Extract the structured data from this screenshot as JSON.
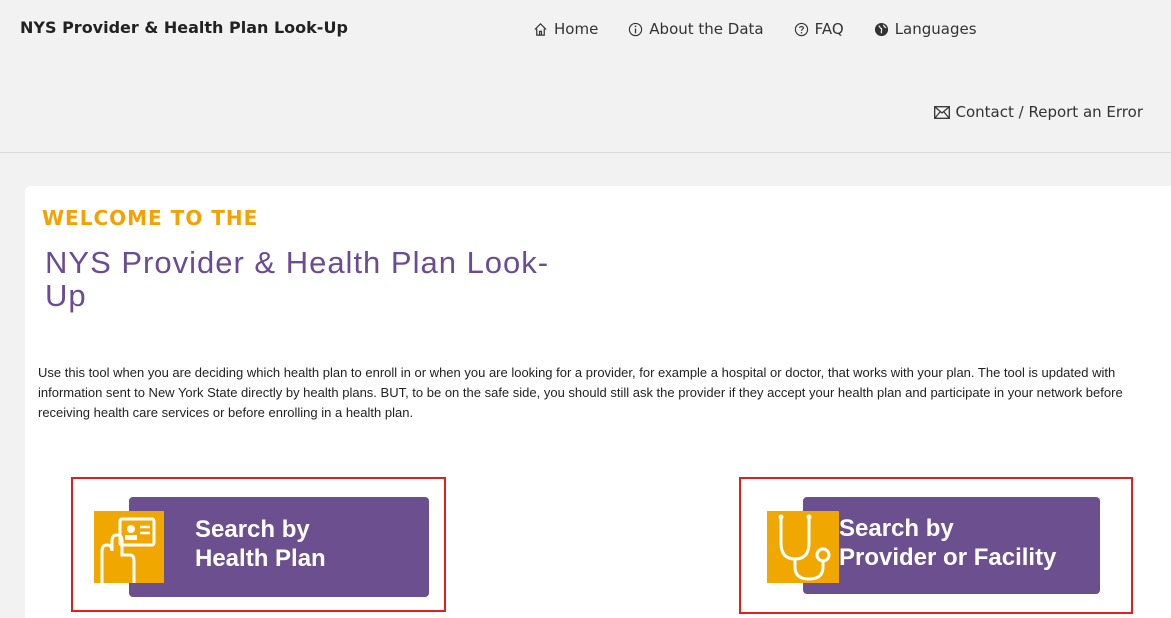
{
  "header": {
    "brand": "NYS Provider & Health Plan Look-Up",
    "nav": [
      {
        "label": "Home",
        "icon": "home-icon"
      },
      {
        "label": "About the Data",
        "icon": "info-icon"
      },
      {
        "label": "FAQ",
        "icon": "question-icon"
      },
      {
        "label": "Languages",
        "icon": "globe-icon"
      }
    ],
    "contact": {
      "label": "Contact / Report an Error",
      "icon": "envelope-icon"
    }
  },
  "main": {
    "welcome": "WELCOME TO THE",
    "title": "NYS Provider & Health Plan Look-Up",
    "description": "Use this tool when you are deciding which health plan to enroll in or when you are looking for a provider, for example a hospital or doctor, that works with your plan. The tool is updated with information sent to New York State directly by health plans. BUT, to be on the safe side, you should still ask the provider if they accept your health plan and participate in your network before receiving health care services or before enrolling in a health plan."
  },
  "buttons": {
    "health_plan": {
      "line1": "Search by",
      "line2": "Health Plan",
      "icon": "id-card-hand-icon"
    },
    "provider": {
      "line1": "Search by",
      "line2": "Provider or Facility",
      "icon": "stethoscope-icon"
    }
  },
  "colors": {
    "accent_purple": "#6c4f8f",
    "accent_orange": "#f0a800",
    "title_purple": "#6a4c93",
    "highlight_red": "#e02020"
  }
}
